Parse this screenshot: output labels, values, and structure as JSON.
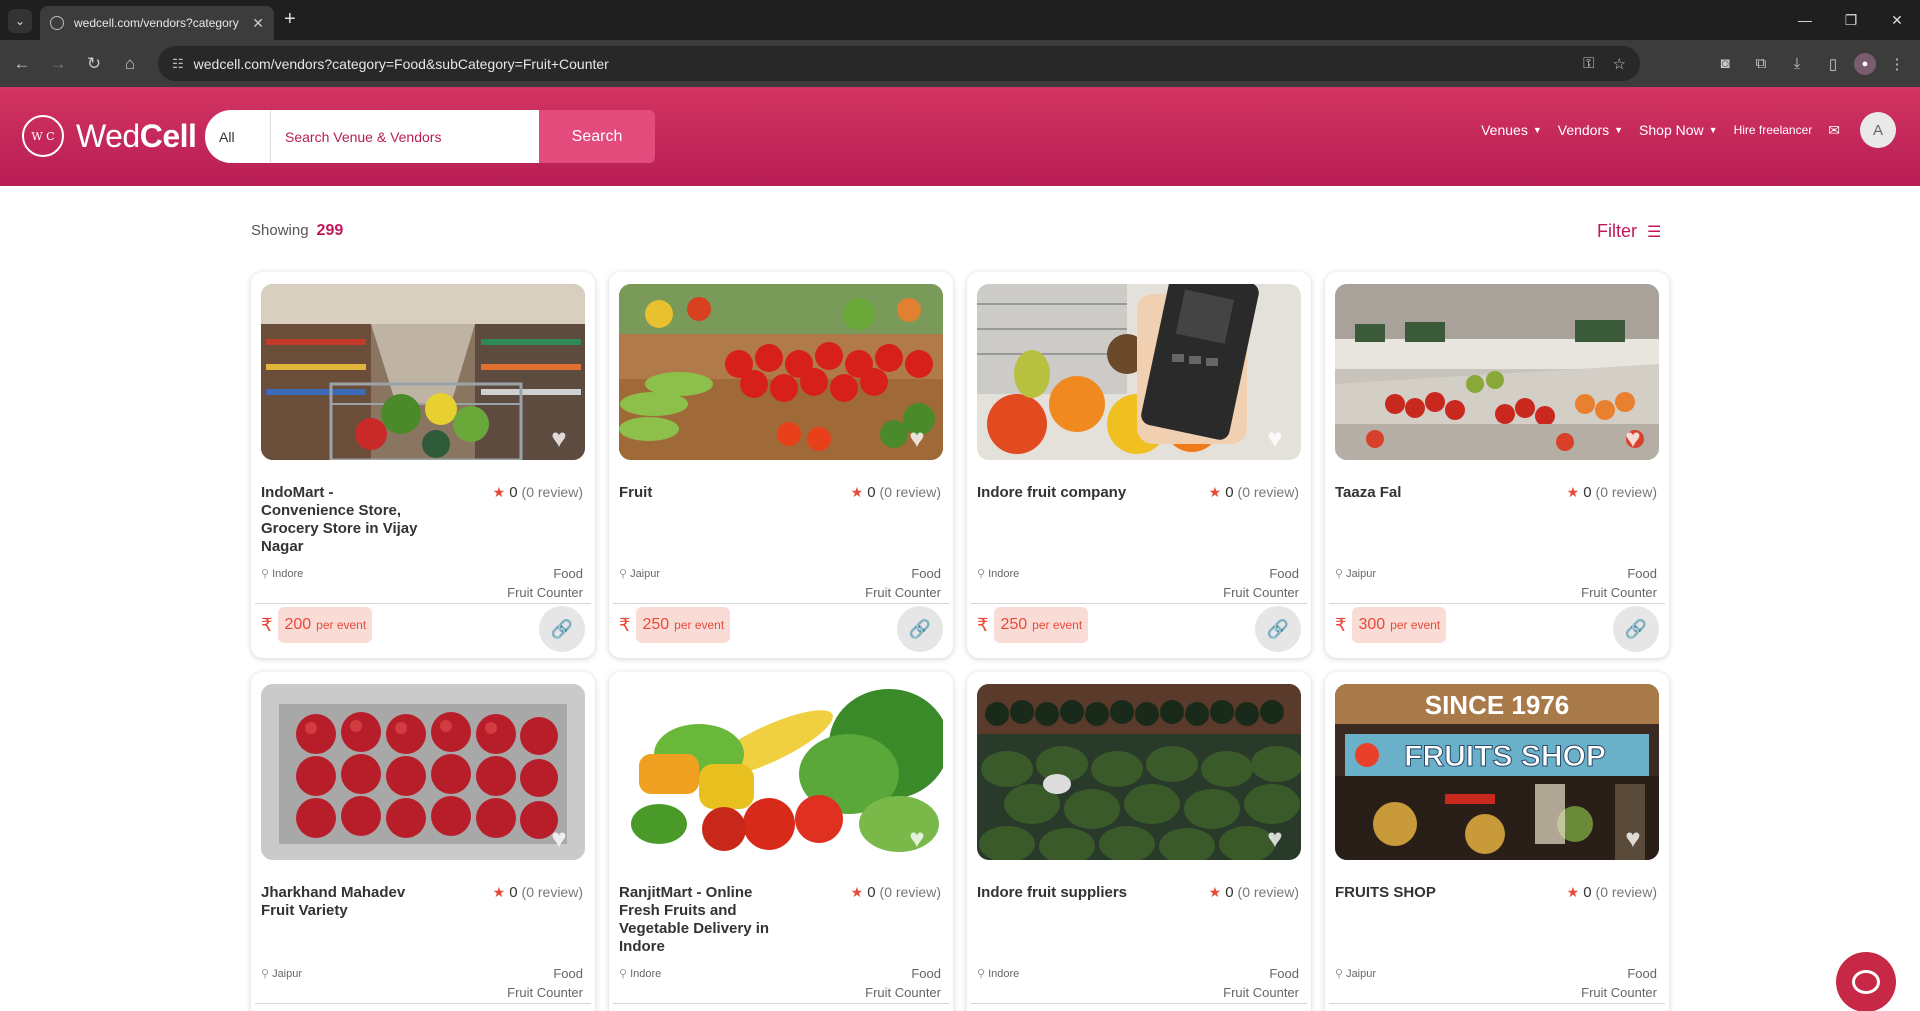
{
  "browser": {
    "tab_title": "wedcell.com/vendors?category",
    "url": "wedcell.com/vendors?category=Food&subCategory=Fruit+Counter"
  },
  "header": {
    "logo_mark": "W C",
    "logo_text_light": "Wed",
    "logo_text_bold": "Cell",
    "search_category": "All",
    "search_placeholder": "Search Venue & Vendors",
    "search_button": "Search",
    "nav": [
      "Venues",
      "Vendors",
      "Shop Now",
      "Hire freelancer"
    ],
    "avatar_letter": "A",
    "brand_color": "#c2185b"
  },
  "results": {
    "showing_label": "Showing",
    "count": "299",
    "filter_label": "Filter"
  },
  "vendors": [
    {
      "name": "IndoMart - Convenience Store, Grocery Store in Vijay Nagar",
      "rating": "0",
      "reviews": "(0 review)",
      "location": "Indore",
      "category": "Food",
      "subcategory": "Fruit Counter",
      "price": "200",
      "unit": "per event"
    },
    {
      "name": "Fruit",
      "rating": "0",
      "reviews": "(0 review)",
      "location": "Jaipur",
      "category": "Food",
      "subcategory": "Fruit Counter",
      "price": "250",
      "unit": "per event"
    },
    {
      "name": "Indore fruit company",
      "rating": "0",
      "reviews": "(0 review)",
      "location": "Indore",
      "category": "Food",
      "subcategory": "Fruit Counter",
      "price": "250",
      "unit": "per event"
    },
    {
      "name": "Taaza Fal",
      "rating": "0",
      "reviews": "(0 review)",
      "location": "Jaipur",
      "category": "Food",
      "subcategory": "Fruit Counter",
      "price": "300",
      "unit": "per event"
    },
    {
      "name": "Jharkhand Mahadev Fruit Variety",
      "rating": "0",
      "reviews": "(0 review)",
      "location": "Jaipur",
      "category": "Food",
      "subcategory": "Fruit Counter",
      "price": "",
      "unit": ""
    },
    {
      "name": "RanjitMart - Online Fresh Fruits and Vegetable Delivery in Indore",
      "rating": "0",
      "reviews": "(0 review)",
      "location": "Indore",
      "category": "Food",
      "subcategory": "Fruit Counter",
      "price": "",
      "unit": ""
    },
    {
      "name": "Indore fruit suppliers",
      "rating": "0",
      "reviews": "(0 review)",
      "location": "Indore",
      "category": "Food",
      "subcategory": "Fruit Counter",
      "price": "",
      "unit": ""
    },
    {
      "name": "FRUITS SHOP",
      "rating": "0",
      "reviews": "(0 review)",
      "location": "Jaipur",
      "category": "Food",
      "subcategory": "Fruit Counter",
      "price": "",
      "unit": ""
    }
  ],
  "photo_texts": {
    "since": "SINCE 1976",
    "fruits_shop": "FRUITS SHOP"
  },
  "icons": [
    "chevron-down-icon",
    "close-icon",
    "plus-icon",
    "back-icon",
    "forward-icon",
    "reload-icon",
    "home-icon",
    "key-icon",
    "star-icon",
    "download-icon",
    "mail-icon",
    "filter-icon",
    "heart-icon",
    "location-pin-icon",
    "rupee-icon",
    "share-icon",
    "chat-icon"
  ]
}
